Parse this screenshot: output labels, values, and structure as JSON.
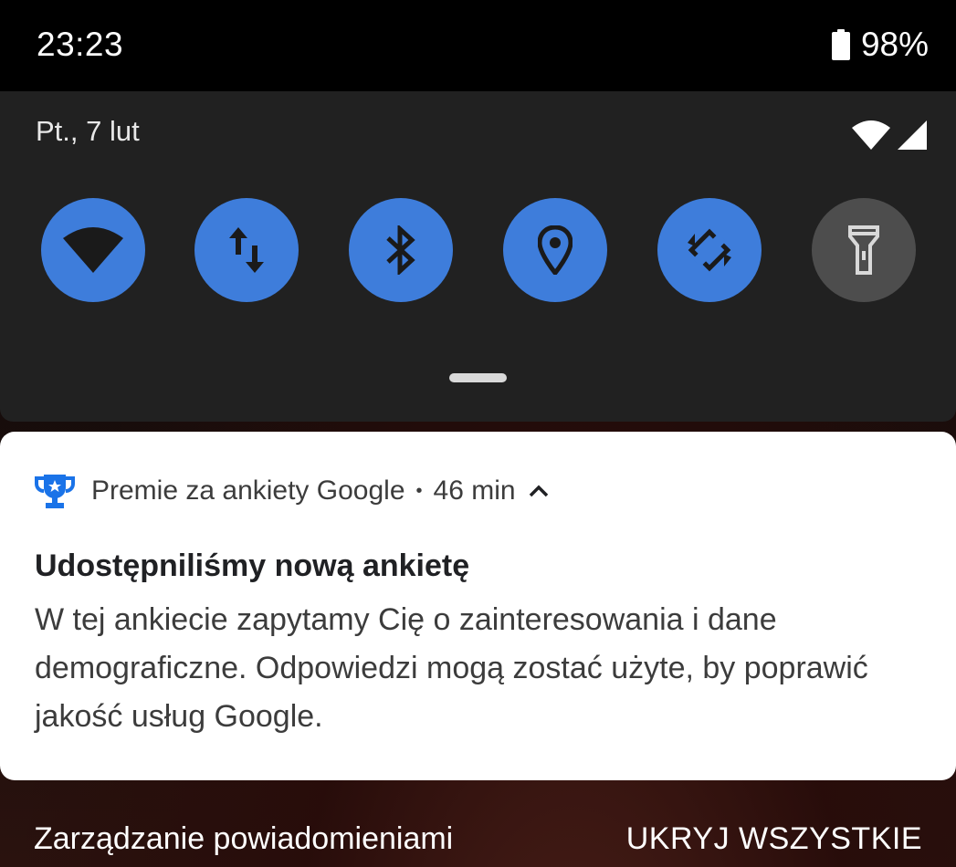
{
  "status_bar": {
    "time": "23:23",
    "battery_percent": "98%",
    "battery_icon": "battery-full-icon"
  },
  "quick_settings": {
    "date": "Pt., 7 lut",
    "signal_icons": [
      "wifi-icon",
      "cellular-signal-icon"
    ],
    "tiles": [
      {
        "name": "wifi",
        "icon": "wifi-icon",
        "active": true
      },
      {
        "name": "mobile-data",
        "icon": "data-arrows-icon",
        "active": true
      },
      {
        "name": "bluetooth",
        "icon": "bluetooth-icon",
        "active": true
      },
      {
        "name": "location",
        "icon": "location-pin-icon",
        "active": true
      },
      {
        "name": "auto-rotate",
        "icon": "rotate-icon",
        "active": true
      },
      {
        "name": "flashlight",
        "icon": "flashlight-icon",
        "active": false
      }
    ],
    "colors": {
      "active_tile": "#3e7ddb",
      "inactive_tile": "#4d4d4d",
      "panel": "#212121"
    }
  },
  "notification": {
    "app_name": "Premie za ankiety Google",
    "separator": "•",
    "time": "46 min",
    "app_icon": "trophy-icon",
    "title": "Udostępniliśmy nową ankietę",
    "body": "W tej ankiecie zapytamy Cię o zainteresowania i dane demograficzne. Odpowiedzi mogą zostać użyte, by poprawić jakość usług Google.",
    "accent_color": "#1a73e8"
  },
  "footer": {
    "manage_label": "Zarządzanie powiadomieniami",
    "clear_all_label": "UKRYJ WSZYSTKIE"
  }
}
